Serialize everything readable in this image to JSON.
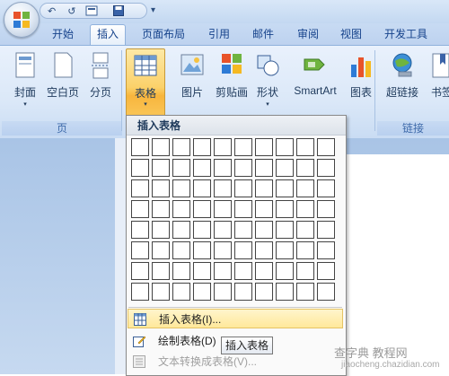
{
  "quick_access": {
    "undo": "↶",
    "redo": "↺",
    "more": "▾"
  },
  "tabs": [
    {
      "label": "开始",
      "active": false
    },
    {
      "label": "插入",
      "active": true
    },
    {
      "label": "页面布局",
      "active": false
    },
    {
      "label": "引用",
      "active": false
    },
    {
      "label": "邮件",
      "active": false
    },
    {
      "label": "审阅",
      "active": false
    },
    {
      "label": "视图",
      "active": false
    },
    {
      "label": "开发工具",
      "active": false
    }
  ],
  "ribbon": {
    "groups": {
      "pages": {
        "label": "页"
      },
      "links": {
        "label": "链接"
      }
    },
    "buttons": {
      "cover": "封面",
      "blank_page": "空白页",
      "page_break": "分页",
      "table": "表格",
      "picture": "图片",
      "clip_art": "剪贴画",
      "shapes": "形状",
      "smartart": "SmartArt",
      "chart": "图表",
      "hyperlink": "超链接",
      "bookmark": "书签"
    },
    "dropdown_arrow": "▾"
  },
  "table_menu": {
    "header": "插入表格",
    "grid": {
      "columns": 10,
      "rows": 8
    },
    "items": {
      "insert_table": "插入表格(I)...",
      "draw_table": "绘制表格(D)",
      "convert_text": "文本转换成表格(V)..."
    }
  },
  "tooltip": "插入表格",
  "watermark": {
    "line1": "查字典 教程网",
    "line2": "jiaocheng.chazidian.com"
  },
  "colors": {
    "accent": "#15428b",
    "table_button": "#f8b53d",
    "hover": "#ffe89a"
  }
}
